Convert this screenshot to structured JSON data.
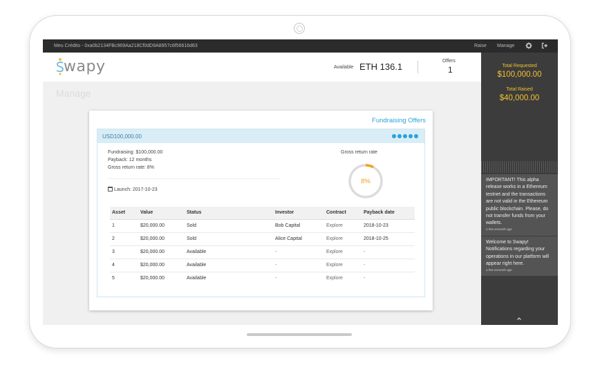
{
  "topbar": {
    "credit": "Meu Crédito - 0xa0b2134FBc969Aa218Cf0dD9A8957c6f56616d63",
    "nav": [
      "Raise",
      "Manage"
    ],
    "icons": [
      "gear-icon",
      "sign-out-icon"
    ]
  },
  "header": {
    "logo_text": "wapy",
    "logo_colors": [
      "#f2c22e",
      "#5fb3e0",
      "#8a8a8a"
    ],
    "available_label": "Available",
    "available_value": "ETH 136.1",
    "offers_label": "Offers",
    "offers_value": "1"
  },
  "page": {
    "title": "Manage"
  },
  "card": {
    "title": "Fundraising Offers",
    "offer": {
      "amount": "USD100,000.00",
      "progress_dots": 5,
      "details": [
        "Fundraising: $100,000.00",
        "Payback: 12 months",
        "Gross return rate: 8%"
      ],
      "launch": "Launch: 2017-10-23",
      "gross_label": "Gross return rate",
      "gross_value": "8%",
      "gross_fraction": 0.08,
      "table": {
        "headers": [
          "Asset",
          "Value",
          "Status",
          "Investor",
          "Contract",
          "Payback date"
        ],
        "rows": [
          [
            "1",
            "$20,000.00",
            "Sold",
            "Bob Capital",
            "Explore",
            "2018-10-23"
          ],
          [
            "2",
            "$20,000.00",
            "Sold",
            "Alice Capital",
            "Explore",
            "2018-10-25"
          ],
          [
            "3",
            "$20,000.00",
            "Available",
            "-",
            "Explore",
            "-"
          ],
          [
            "4",
            "$20,000.00",
            "Available",
            "-",
            "Explore",
            "-"
          ],
          [
            "5",
            "$20,000.00",
            "Available",
            "-",
            "Explore",
            "-"
          ]
        ]
      }
    }
  },
  "sidebar": {
    "requested_label": "Total Requested",
    "requested_value": "$100,000.00",
    "raised_label": "Total Raised",
    "raised_value": "$40,000.00",
    "notifications": [
      {
        "text": "IMPORTANT! This alpha release works in a Ethereum testnet and the transactions are not valid in the Ethereum public blockchain. Please, do not transfer funds from your wallets.",
        "time": "a few seconds ago"
      },
      {
        "text": "Welcome to Swapy! Notifications regarding your operations in our platform will appear right here.",
        "time": "a few seconds ago"
      }
    ]
  },
  "colors": {
    "accent": "#2aa3d8",
    "gold": "#f2c22e",
    "ring": "#f0a020"
  }
}
